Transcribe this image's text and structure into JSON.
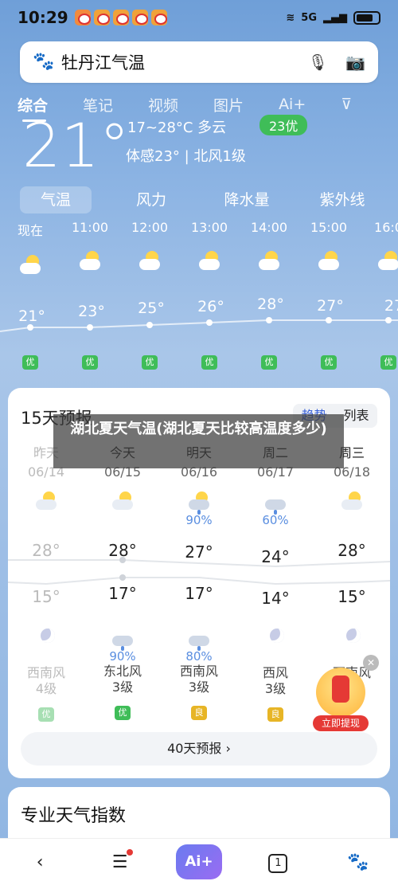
{
  "status": {
    "time": "10:29",
    "network": "5G"
  },
  "search": {
    "query": "牡丹江气温"
  },
  "tabs": [
    "综合",
    "笔记",
    "视频",
    "图片",
    "Ai+"
  ],
  "current": {
    "temp": "21°",
    "range": "17~28°C 多云",
    "aqi": "23优",
    "feels": "体感23° | 北风1级"
  },
  "subtabs": [
    "气温",
    "风力",
    "降水量",
    "紫外线"
  ],
  "hourly": [
    {
      "time": "现在",
      "temp": "21°",
      "aqi": "优"
    },
    {
      "time": "11:00",
      "temp": "23°",
      "aqi": "优"
    },
    {
      "time": "12:00",
      "temp": "25°",
      "aqi": "优"
    },
    {
      "time": "13:00",
      "temp": "26°",
      "aqi": "优"
    },
    {
      "time": "14:00",
      "temp": "28°",
      "aqi": "优"
    },
    {
      "time": "15:00",
      "temp": "27°",
      "aqi": "优"
    },
    {
      "time": "16:0",
      "temp": "27",
      "aqi": "优"
    }
  ],
  "forecast": {
    "title": "15天预报",
    "toggle": [
      "趋势",
      "列表"
    ],
    "days": [
      {
        "name": "昨天",
        "date": "06/14",
        "pct": "",
        "high": "28°",
        "low": "15°",
        "night_pct": "",
        "wind": "西南风",
        "level": "4级",
        "aqi": "优"
      },
      {
        "name": "今天",
        "date": "06/15",
        "pct": "",
        "high": "28°",
        "low": "17°",
        "night_pct": "90%",
        "wind": "东北风",
        "level": "3级",
        "aqi": "优"
      },
      {
        "name": "明天",
        "date": "06/16",
        "pct": "90%",
        "high": "27°",
        "low": "17°",
        "night_pct": "80%",
        "wind": "西南风",
        "level": "3级",
        "aqi": "良"
      },
      {
        "name": "周二",
        "date": "06/17",
        "pct": "60%",
        "high": "24°",
        "low": "14°",
        "night_pct": "",
        "wind": "西风",
        "level": "3级",
        "aqi": "良"
      },
      {
        "name": "周三",
        "date": "06/18",
        "pct": "",
        "high": "28°",
        "low": "15°",
        "night_pct": "",
        "wind": "西南风",
        "level": "",
        "aqi": ""
      }
    ],
    "more": "40天预报 ›"
  },
  "overlay": "湖北夏天气温(湖北夏天比较高温度多少)",
  "redpacket": "立即提现",
  "pro": {
    "title": "专业天气指数"
  },
  "nav": {
    "ai": "Ai+",
    "tabs_count": "1"
  }
}
